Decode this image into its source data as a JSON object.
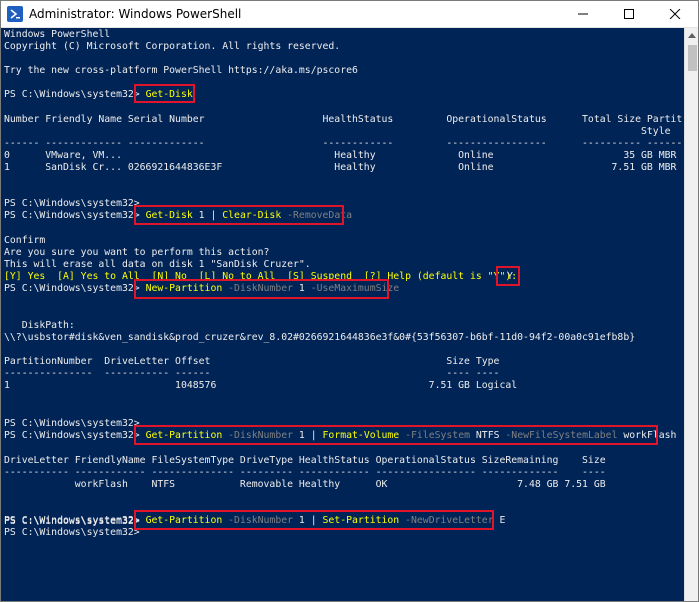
{
  "window": {
    "title": "Administrator: Windows PowerShell"
  },
  "console": {
    "lines": {
      "banner1": "Windows PowerShell",
      "banner2": "Copyright (C) Microsoft Corporation. All rights reserved.",
      "banner3": "Try the new cross-platform PowerShell https://aka.ms/pscore6",
      "disk_header1": "Number Friendly Name Serial Number                    HealthStatus         OperationalStatus      Total Size Partition",
      "disk_header2": "                                                                                                            Style",
      "disk_sep": "------ ------------- -------------                    ------------         -----------------      ---------- ---------",
      "disk_row0": "0      VMware, VM...                                    Healthy              Online                      35 GB MBR",
      "disk_row1": "1      SanDisk Cr... 0266921644836E3F                   Healthy              Online                    7.51 GB MBR",
      "prompt_blank1": "PS C:\\Windows\\system32>",
      "confirm": "Confirm",
      "confirm_q": "Are you sure you want to perform this action?",
      "confirm_detail": "This will erase all data on disk 1 \"SanDisk Cruzer\".",
      "confirm_choices": "[Y] Yes  [A] Yes to All  [N] No  [L] No to All  [S] Suspend  [?] Help (default is \"Y\"): ",
      "confirm_answer": "Y",
      "diskpath_label": "   DiskPath:",
      "diskpath_value": "\\\\?\\usbstor#disk&ven_sandisk&prod_cruzer&rev_8.02#0266921644836e3f&0#{53f56307-b6bf-11d0-94f2-00a0c91efb8b}",
      "part_header": "PartitionNumber  DriveLetter Offset                                        Size Type",
      "part_sep": "---------------  ----------- ------                                        ---- ----",
      "part_row": "1                            1048576                                    7.51 GB Logical",
      "prompt_blank2": "PS C:\\Windows\\system32>",
      "vol_header": "DriveLetter FriendlyName FileSystemType DriveType HealthStatus OperationalStatus SizeRemaining    Size",
      "vol_sep": "----------- ------------ -------------- --------- ------------ ----------------- -------------    ----",
      "vol_row": "            workFlash    NTFS           Removable Healthy      OK                      7.48 GB 7.51 GB",
      "prompt_blank3": "PS C:\\Windows\\system32>",
      "prompt_final": "PS C:\\Windows\\system32>"
    },
    "prompt": "PS C:\\Windows\\system32> ",
    "cmd1": {
      "name": "Get-Disk"
    },
    "cmd2": {
      "name": "Get-Disk",
      "arg": " 1 ",
      "pipe": "| ",
      "name2": "Clear-Disk",
      "param": " -RemoveData"
    },
    "cmd3": {
      "name": "New-Partition",
      "p1": " -DiskNumber",
      "v1": " 1",
      "p2": " -UseMaximumSize"
    },
    "cmd4": {
      "name": "Get-Partition",
      "p1": " -DiskNumber",
      "v1": " 1 ",
      "pipe": "| ",
      "name2": "Format-Volume",
      "p2": " -FileSystem",
      "v2": " NTFS",
      "p3": " -NewFileSystemLabel",
      "v3": " workFlash"
    },
    "cmd5": {
      "name": "Get-Partition",
      "p1": " -DiskNumber",
      "v1": " 1 ",
      "pipe": "| ",
      "name2": "Set-Partition",
      "p2": " -NewDriveLetter",
      "v2": " E"
    }
  },
  "colors": {
    "console_bg": "#012456",
    "text": "#eeeded",
    "command": "#ffff00",
    "parameter": "#808080",
    "highlight": "#e0152a"
  },
  "icons": {
    "app": "powershell-icon",
    "minimize": "minimize-icon",
    "maximize": "maximize-icon",
    "close": "close-icon",
    "scroll_up": "scroll-up-arrow-icon"
  }
}
